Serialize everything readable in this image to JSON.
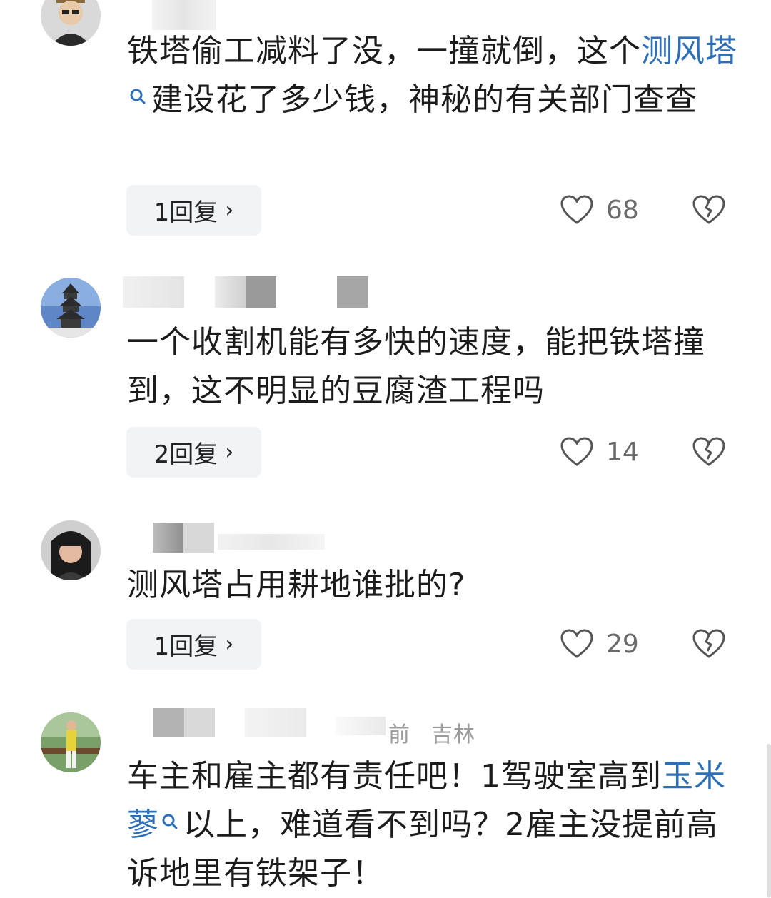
{
  "comments": [
    {
      "text_parts": [
        "铁塔偷工减料了没，一撞就倒，这个",
        "测风塔",
        "建设花了多少钱，神秘的有关部门查查"
      ],
      "reply_label": "1回复",
      "likes": "68"
    },
    {
      "text": "一个收割机能有多快的速度，能把铁塔撞到，这不明显的豆腐渣工程吗",
      "reply_label": "2回复",
      "likes": "14"
    },
    {
      "text": "测风塔占用耕地谁批的?",
      "reply_label": "1回复",
      "likes": "29"
    },
    {
      "meta_time": "前",
      "meta_location": "吉林",
      "text_parts": [
        "车主和雇主都有责任吧！1驾驶室高到",
        "玉米蓼",
        "以上，难道看不到吗？2雇主没提前高诉地里有铁架子！"
      ]
    }
  ],
  "colors": {
    "link": "#2d6fb8",
    "reply_bg": "#f2f3f5",
    "text": "#1c1c1c",
    "muted": "#9b9b9b"
  }
}
